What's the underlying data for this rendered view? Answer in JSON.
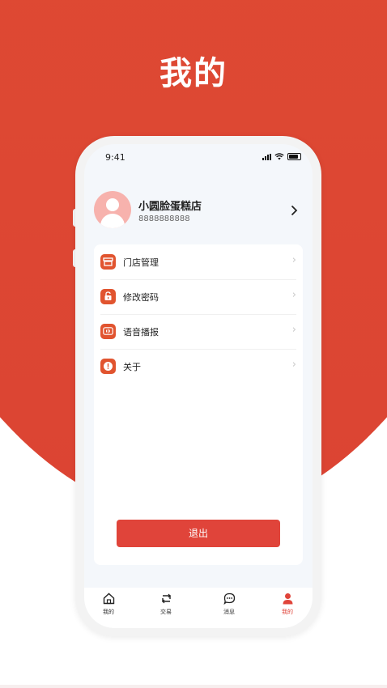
{
  "headline": "我的",
  "status": {
    "time": "9:41"
  },
  "profile": {
    "name": "小圆脸蛋糕店",
    "phone": "8888888888"
  },
  "menu": [
    {
      "label": "门店管理",
      "icon": "store-icon"
    },
    {
      "label": "修改密码",
      "icon": "unlock-icon"
    },
    {
      "label": "语音播报",
      "icon": "voice-icon"
    },
    {
      "label": "关于",
      "icon": "info-icon"
    }
  ],
  "logout_label": "退出",
  "tabs": [
    {
      "label": "我的",
      "icon": "home-icon"
    },
    {
      "label": "交易",
      "icon": "exchange-icon"
    },
    {
      "label": "消息",
      "icon": "message-icon"
    },
    {
      "label": "我的",
      "icon": "user-icon",
      "active": true
    }
  ],
  "colors": {
    "brand": "#e0443a",
    "background_top": "#e2633a",
    "text": "#222222"
  }
}
